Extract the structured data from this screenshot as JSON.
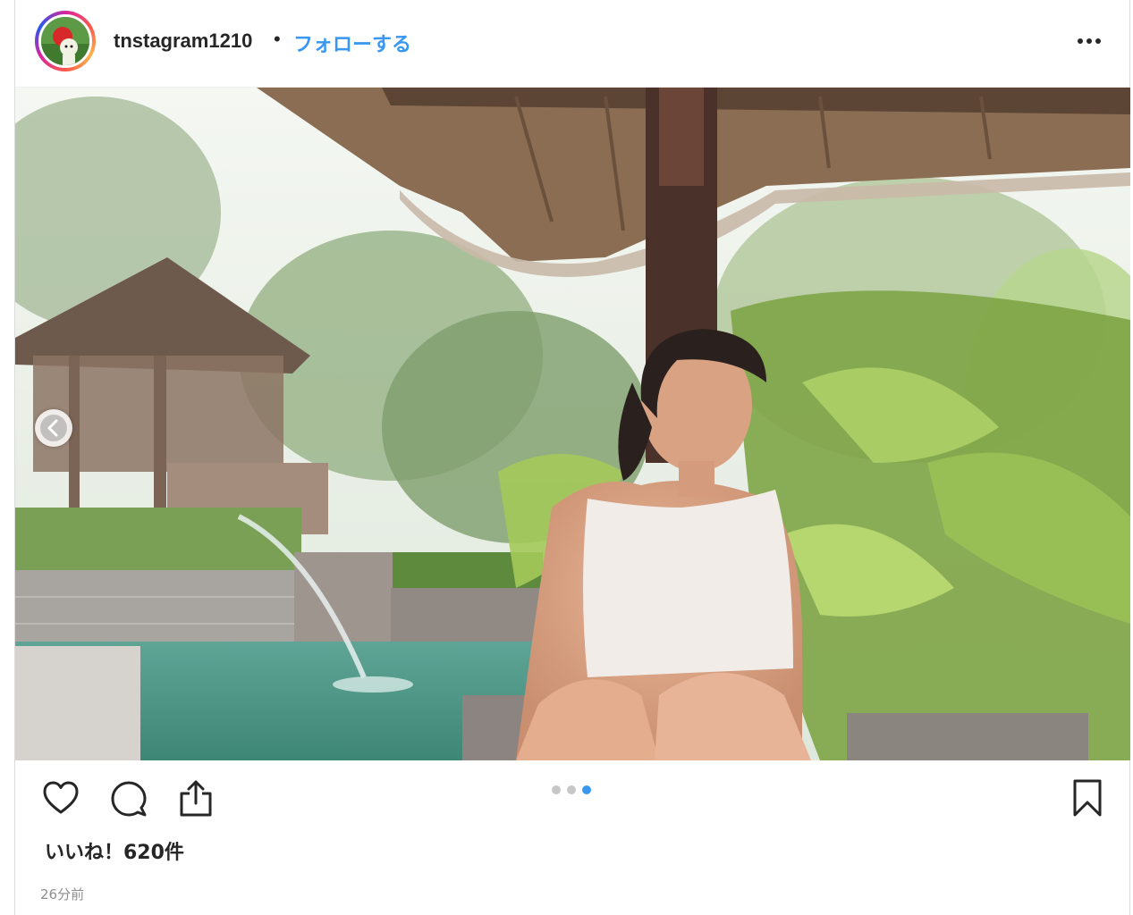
{
  "header": {
    "username": "tnstagram1210",
    "separator": "•",
    "follow_label": "フォローする",
    "more_icon": "more-horizontal-icon"
  },
  "post": {
    "image_alt": "photo",
    "carousel": {
      "count": 3,
      "active_index": 2
    }
  },
  "actions": {
    "like_icon": "heart-icon",
    "comment_icon": "comment-icon",
    "share_icon": "share-icon",
    "save_icon": "bookmark-icon"
  },
  "likes_text": "いいね！620件",
  "timestamp": "26分前",
  "colors": {
    "accent": "#3897f0",
    "text": "#262626",
    "muted": "#8e8e8e",
    "border": "#dbdbdb"
  }
}
